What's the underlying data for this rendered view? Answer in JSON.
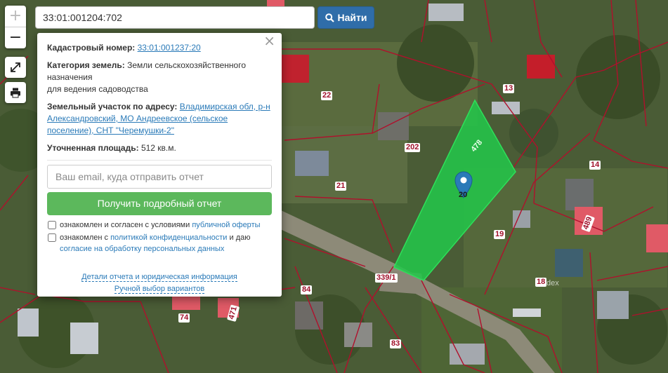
{
  "search": {
    "value": "33:01:001204:702",
    "button_label": "Найти"
  },
  "map_controls": {
    "zoom_in": "+",
    "zoom_out": "−"
  },
  "popup": {
    "cadastral_label": "Кадастровый номер:",
    "cadastral_value": "33:01:001237:20",
    "category_label": "Категория земель:",
    "category_value_1": "Земли сельскохозяйственного",
    "category_value_2": "назначения",
    "category_value_3": "для ведения садоводства",
    "address_label": "Земельный участок по адресу:",
    "address_value_1": "Владимирская обл, р-н",
    "address_value_2": "Александровский, МО Андреевское (сельское",
    "address_value_3": "поселение), СНТ \"Черемушки-2\"",
    "area_label": "Уточненная площадь:",
    "area_value": "512 кв.м.",
    "email_placeholder": "Ваш email, куда отправить отчет",
    "report_button": "Получить подробный отчет",
    "consent1_text": "ознакомлен и согласен с условиями",
    "consent1_link": "публичной оферты",
    "consent2_text": "ознакомлен с",
    "consent2_link1": "политикой конфиденциальности",
    "consent2_mid": "и даю",
    "consent2_link2": "согласие на обработку персональных данных",
    "details_link": "Детали отчета и юридическая информация",
    "manual_link": "Ручной выбор вариантов"
  },
  "parcel_labels": {
    "p22": "22",
    "p13": "13",
    "p14": "14",
    "p202": "202",
    "p478": "478",
    "p21": "21",
    "p20": "20",
    "p19": "19",
    "p489": "489",
    "p3391": "339/1",
    "p18": "18",
    "p84": "84",
    "p74": "74",
    "p471": "471",
    "p83": "83"
  },
  "watermark": "dex",
  "colors": {
    "parcel_border": "#b0102c",
    "selected_parcel": "#22c84a",
    "find_button": "#2f6da9",
    "report_button": "#5cb85c",
    "link": "#2a7ab8"
  }
}
